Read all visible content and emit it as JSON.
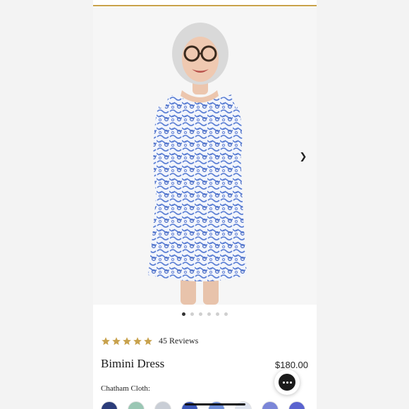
{
  "product": {
    "title": "Bimini Dress",
    "price": "$180.00",
    "rating": 5,
    "reviews": "45 Reviews",
    "swatch_label": "Chatham Cloth:"
  },
  "gallery": {
    "image_count": 6,
    "active_index": 0,
    "next_icon": "chevron-right-icon"
  },
  "chat": {
    "icon": "chat-bubble-icon"
  },
  "colors": {
    "accent_gold": "#c9a24a",
    "star": "#c8a24d",
    "dress_blue": "#5b7fd4",
    "text": "#1a1a1a"
  },
  "swatches": [
    {
      "name": "navy-print",
      "color": "#2c3d7a"
    },
    {
      "name": "green-print",
      "color": "#9ac7b4"
    },
    {
      "name": "grey-print",
      "color": "#c9ced6"
    },
    {
      "name": "blue-print",
      "color": "#3b57b8"
    },
    {
      "name": "blue-white-print",
      "color": "#6f8ed8"
    },
    {
      "name": "light-print",
      "color": "#dfe4ef"
    },
    {
      "name": "periwinkle-print",
      "color": "#7b86d8"
    },
    {
      "name": "royal-print",
      "color": "#5a63cf"
    }
  ]
}
